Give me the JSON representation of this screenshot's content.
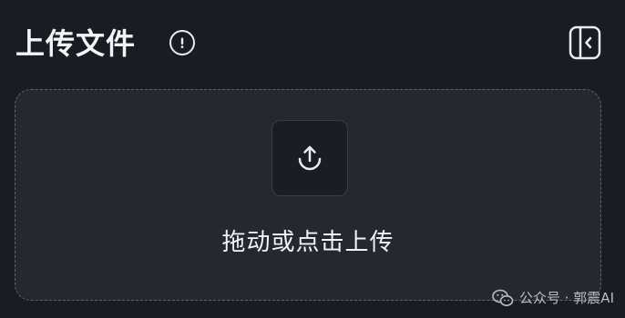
{
  "header": {
    "title": "上传文件",
    "info_icon": "info-icon",
    "collapse_icon": "sidebar-collapse-icon"
  },
  "dropzone": {
    "icon": "upload-icon",
    "label": "拖动或点击上传"
  },
  "watermark": {
    "text": "公众号 · 郭震AI",
    "icon": "wechat-icon"
  },
  "colors": {
    "background": "#191c22",
    "dropzone_bg": "#242931",
    "dropzone_border": "#5c6470",
    "tile_bg": "#1a1d23",
    "text": "#f2f4f7"
  }
}
